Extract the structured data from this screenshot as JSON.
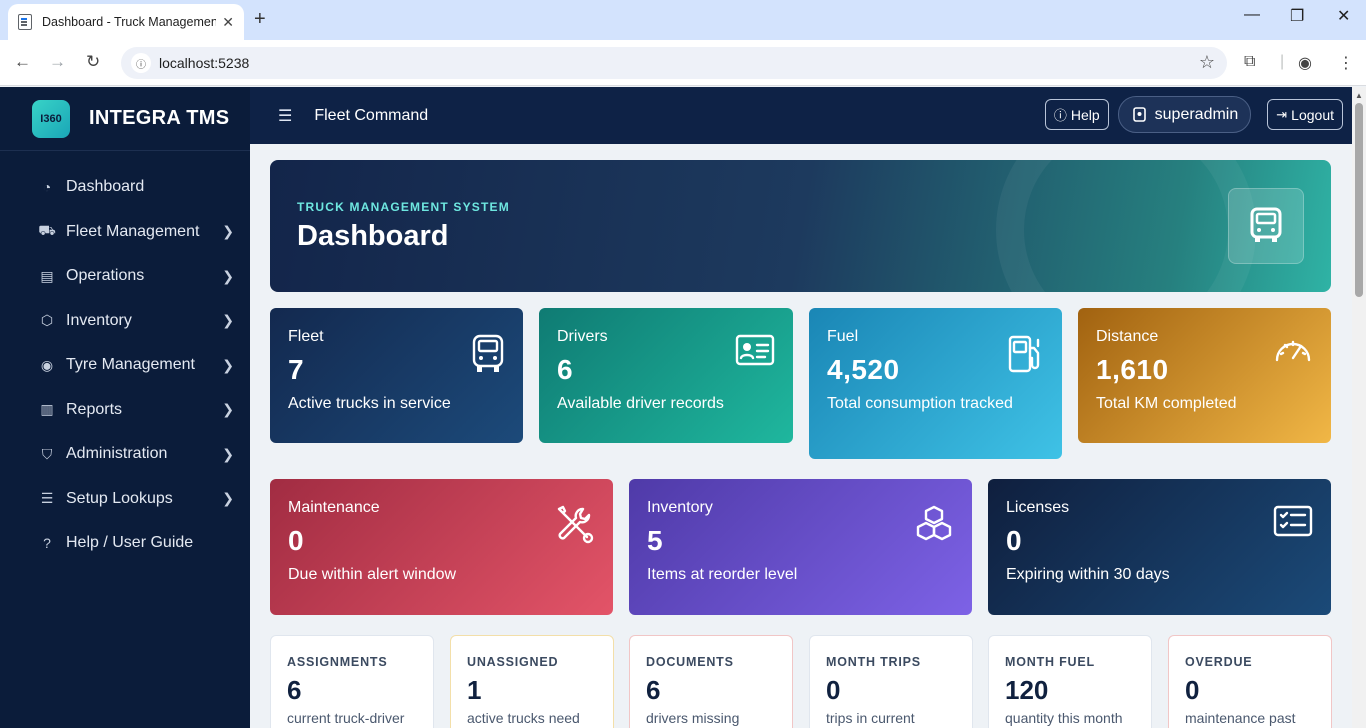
{
  "browser": {
    "tab_title": "Dashboard - Truck Management",
    "url": "localhost:5238"
  },
  "brand": {
    "logo": "I360",
    "name": "INTEGRA TMS"
  },
  "sidebar": {
    "items": [
      {
        "label": "Dashboard",
        "icon": "gauge-icon",
        "chevron": false
      },
      {
        "label": "Fleet Management",
        "icon": "truck-icon",
        "chevron": true
      },
      {
        "label": "Operations",
        "icon": "clipboard-icon",
        "chevron": true
      },
      {
        "label": "Inventory",
        "icon": "box-icon",
        "chevron": true
      },
      {
        "label": "Tyre Management",
        "icon": "tyre-icon",
        "chevron": true
      },
      {
        "label": "Reports",
        "icon": "report-icon",
        "chevron": true
      },
      {
        "label": "Administration",
        "icon": "shield-icon",
        "chevron": true
      },
      {
        "label": "Setup Lookups",
        "icon": "list-icon",
        "chevron": true
      },
      {
        "label": "Help / User Guide",
        "icon": "help-icon",
        "chevron": false
      }
    ]
  },
  "topbar": {
    "title": "Fleet Command",
    "help_label": "Help",
    "user_label": "superadmin",
    "logout_label": "Logout"
  },
  "hero": {
    "kicker": "TRUCK MANAGEMENT SYSTEM",
    "title": "Dashboard"
  },
  "stats": [
    {
      "label": "Fleet",
      "value": "7",
      "desc": "Active trucks in service",
      "icon": "bus-icon"
    },
    {
      "label": "Drivers",
      "value": "6",
      "desc": "Available driver records",
      "icon": "id-card-icon"
    },
    {
      "label": "Fuel",
      "value": "4,520",
      "desc": "Total consumption tracked",
      "icon": "fuel-pump-icon"
    },
    {
      "label": "Distance",
      "value": "1,610",
      "desc": "Total KM completed",
      "icon": "speedometer-icon"
    }
  ],
  "alerts": [
    {
      "label": "Maintenance",
      "value": "0",
      "desc": "Due within alert window",
      "icon": "tools-icon"
    },
    {
      "label": "Inventory",
      "value": "5",
      "desc": "Items at reorder level",
      "icon": "boxes-icon"
    },
    {
      "label": "Licenses",
      "value": "0",
      "desc": "Expiring within 30 days",
      "icon": "checklist-icon"
    }
  ],
  "summary": [
    {
      "label": "ASSIGNMENTS",
      "value": "6",
      "desc": "current truck-driver",
      "border": "#e0e6ee"
    },
    {
      "label": "UNASSIGNED",
      "value": "1",
      "desc": "active trucks need",
      "border": "#f3dfa9"
    },
    {
      "label": "DOCUMENTS",
      "value": "6",
      "desc": "drivers missing",
      "border": "#f1c6c6"
    },
    {
      "label": "MONTH TRIPS",
      "value": "0",
      "desc": "trips in current",
      "border": "#e0e6ee"
    },
    {
      "label": "MONTH FUEL",
      "value": "120",
      "desc": "quantity this month",
      "border": "#e0e6ee"
    },
    {
      "label": "OVERDUE",
      "value": "0",
      "desc": "maintenance past",
      "border": "#f1c6c6"
    }
  ]
}
